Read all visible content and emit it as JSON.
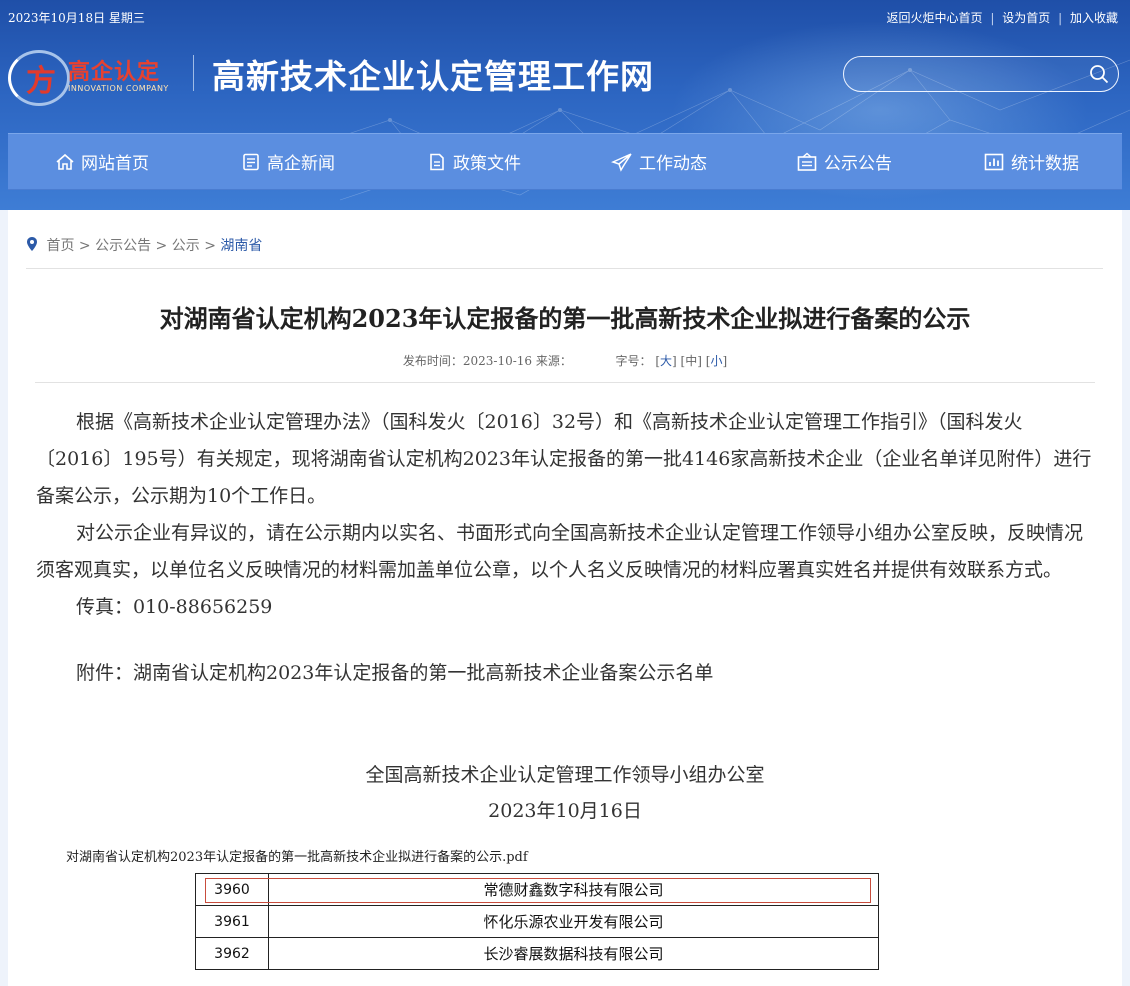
{
  "topbar": {
    "date": "2023年10月18日 星期三",
    "links": [
      "返回火炬中心首页",
      "设为首页",
      "加入收藏"
    ],
    "separator": "|"
  },
  "logo": {
    "brand_cn": "高企认定",
    "brand_en": "INNOVATION COMPANY"
  },
  "site_title": "高新技术企业认定管理工作网",
  "search": {
    "placeholder": "",
    "value": ""
  },
  "nav": {
    "items": [
      {
        "label": "网站首页",
        "icon": "home-icon"
      },
      {
        "label": "高企新闻",
        "icon": "news-icon"
      },
      {
        "label": "政策文件",
        "icon": "document-icon"
      },
      {
        "label": "工作动态",
        "icon": "paper-plane-icon"
      },
      {
        "label": "公示公告",
        "icon": "announcement-icon"
      },
      {
        "label": "统计数据",
        "icon": "chart-icon"
      }
    ]
  },
  "breadcrumb": {
    "items": [
      "首页",
      "公示公告",
      "公示"
    ],
    "current": "湖南省",
    "separator": ">"
  },
  "article": {
    "title": "对湖南省认定机构2023年认定报备的第一批高新技术企业拟进行备案的公示",
    "meta_publish": "发布时间：2023-10-16 来源：",
    "meta_fontsize_label": "字号：",
    "font_sizes": [
      "大",
      "中",
      "小"
    ],
    "paragraphs": [
      "根据《高新技术企业认定管理办法》（国科发火〔2016〕32号）和《高新技术企业认定管理工作指引》（国科发火〔2016〕195号）有关规定，现将湖南省认定机构2023年认定报备的第一批4146家高新技术企业（企业名单详见附件）进行备案公示，公示期为10个工作日。",
      "对公示企业有异议的，请在公示期内以实名、书面形式向全国高新技术企业认定管理工作领导小组办公室反映，反映情况须客观真实，以单位名义反映情况的材料需加盖单位公章，以个人名义反映情况的材料应署真实姓名并提供有效联系方式。",
      "传真：010-88656259"
    ],
    "attachment": "附件：湖南省认定机构2023年认定报备的第一批高新技术企业备案公示名单",
    "signature_org": "全国高新技术企业认定管理工作领导小组办公室",
    "signature_date": "2023年10月16日"
  },
  "pdf": {
    "filename": "对湖南省认定机构2023年认定报备的第一批高新技术企业拟进行备案的公示.pdf",
    "rows": [
      {
        "num": "3960",
        "name": "常德财鑫数字科技有限公司"
      },
      {
        "num": "3961",
        "name": "怀化乐源农业开发有限公司"
      },
      {
        "num": "3962",
        "name": "长沙睿展数据科技有限公司"
      }
    ]
  },
  "colors": {
    "banner": "#2d66c2",
    "nav": "#5b8ee0",
    "link": "#2c5aa8",
    "highlight": "#c84c3c"
  }
}
